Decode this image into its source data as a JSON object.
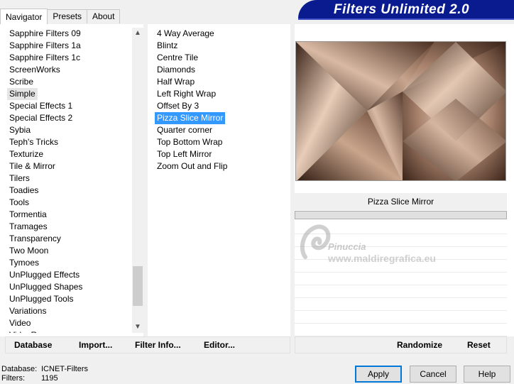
{
  "tabs": [
    "Navigator",
    "Presets",
    "About"
  ],
  "banner": {
    "title": "Filters Unlimited 2.0"
  },
  "categories": [
    "Sapphire Filters 09",
    "Sapphire Filters 1a",
    "Sapphire Filters 1c",
    "ScreenWorks",
    "Scribe",
    "Simple",
    "Special Effects 1",
    "Special Effects 2",
    "Sybia",
    "Teph's Tricks",
    "Texturize",
    "Tile & Mirror",
    "Tilers",
    "Toadies",
    "Tools",
    "Tormentia",
    "Tramages",
    "Transparency",
    "Two Moon",
    "Tymoes",
    "UnPlugged Effects",
    "UnPlugged Shapes",
    "UnPlugged Tools",
    "Variations",
    "Video",
    "VideoRave"
  ],
  "selected_category": "Simple",
  "filters": [
    "4 Way Average",
    "Blintz",
    "Centre Tile",
    "Diamonds",
    "Half Wrap",
    "Left Right Wrap",
    "Offset By 3",
    "Pizza Slice Mirror",
    "Quarter corner",
    "Top Bottom Wrap",
    "Top Left Mirror",
    "Zoom Out and Flip"
  ],
  "selected_filter": "Pizza Slice Mirror",
  "preview_filter_name": "Pizza Slice Mirror",
  "watermark": {
    "name": "Pinuccia",
    "url": "www.maldiregrafica.eu"
  },
  "toolbar": {
    "database": "Database",
    "import": "Import...",
    "filter_info": "Filter Info...",
    "editor": "Editor...",
    "randomize": "Randomize",
    "reset": "Reset"
  },
  "info": {
    "database_label": "Database:",
    "database_value": "ICNET-Filters",
    "filters_label": "Filters:",
    "filters_value": "1195"
  },
  "buttons": {
    "apply": "Apply",
    "cancel": "Cancel",
    "help": "Help"
  },
  "colors": {
    "banner": "#0a1a8f",
    "selection": "#3399ff",
    "preview_dark": "#3a2318",
    "preview_light": "#f2dccb"
  }
}
